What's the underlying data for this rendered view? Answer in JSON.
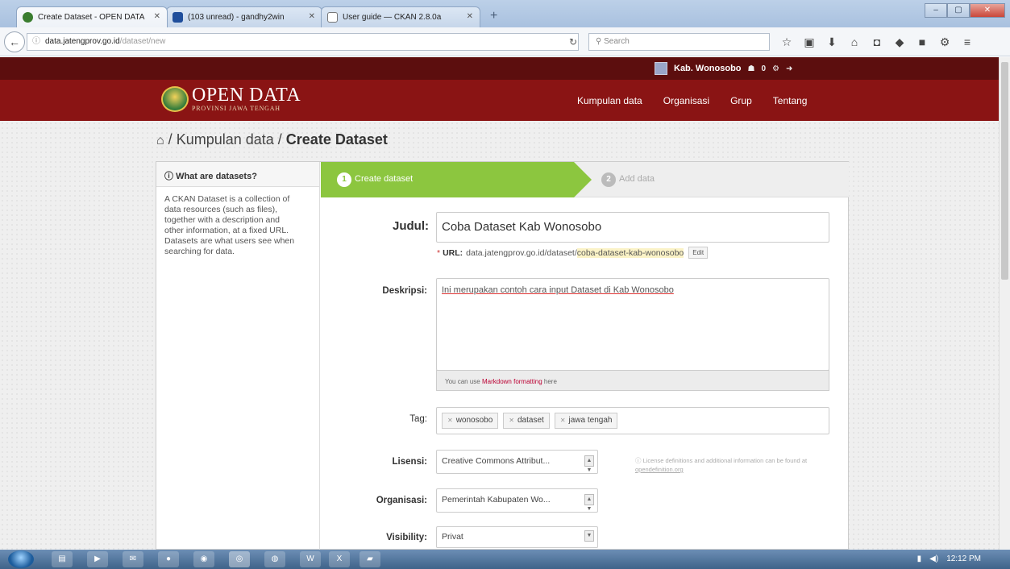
{
  "browser": {
    "tabs": [
      {
        "label": "Create Dataset - OPEN DATA",
        "icon": "open-data-favicon",
        "color": "#3a7d2f"
      },
      {
        "label": "(103 unread) - gandhy2win",
        "icon": "mail-icon",
        "color": "#1f4e9b"
      },
      {
        "label": "User guide — CKAN 2.8.0a",
        "icon": "document-icon",
        "color": "#777777"
      }
    ],
    "url_host": "data.jatengprov.go.id",
    "url_path": "/dataset/new",
    "search_placeholder": "Search",
    "toolbar_icons": [
      "☆",
      "▣",
      "⬇",
      "⌂",
      "◘",
      "◆",
      "■",
      "⚙",
      "≡"
    ]
  },
  "site": {
    "user_name": "Kab. Wonosobo",
    "activity_count": "0",
    "logo_title": "OPEN DATA",
    "logo_subtitle": "PROVINSI JAWA TENGAH",
    "nav": [
      "Kumpulan data",
      "Organisasi",
      "Grup",
      "Tentang"
    ]
  },
  "breadcrumb": {
    "parent": "Kumpulan data",
    "current": "Create Dataset"
  },
  "sidebar": {
    "heading": "What are datasets?",
    "text": "A CKAN Dataset is a collection of data resources (such as files), together with a description and other information, at a fixed URL. Datasets are what users see when searching for data."
  },
  "stages": [
    {
      "number": "1",
      "label": "Create dataset"
    },
    {
      "number": "2",
      "label": "Add data"
    }
  ],
  "form": {
    "title_label": "Judul:",
    "title_value": "Coba Dataset Kab Wonosobo",
    "url_label": "URL:",
    "url_prefix": "data.jatengprov.go.id/dataset/",
    "url_slug": "coba-dataset-kab-wonosobo",
    "edit_label": "Edit",
    "description_label": "Deskripsi:",
    "description_value": "Ini merupakan contoh cara input Dataset di Kab Wonosobo",
    "markdown_hint_prefix": "You can use ",
    "markdown_hint_link": "Markdown formatting",
    "markdown_hint_suffix": " here",
    "tag_label": "Tag:",
    "tags": [
      "wonosobo",
      "dataset",
      "jawa tengah"
    ],
    "license_label": "Lisensi:",
    "license_value": "Creative Commons Attribut...",
    "license_note_prefix": "License definitions and additional information can be found at ",
    "license_note_link": "opendefinition.org",
    "org_label": "Organisasi:",
    "org_value": "Pemerintah Kabupaten Wo...",
    "visibility_label": "Visibility:",
    "visibility_value": "Privat"
  },
  "taskbar": {
    "time": "12:12 PM"
  }
}
